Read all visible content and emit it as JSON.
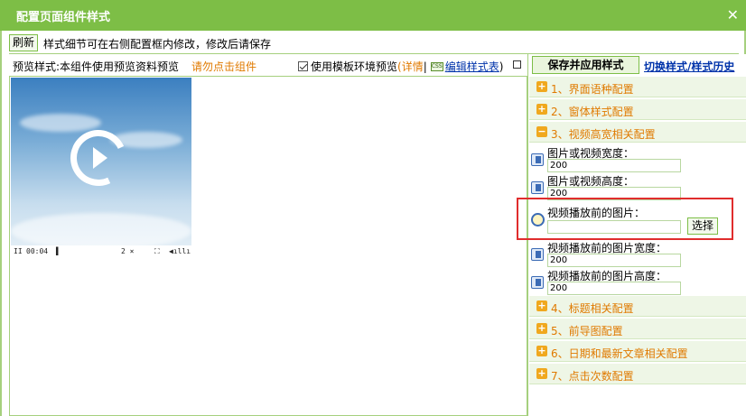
{
  "dialog": {
    "title": "配置页面组件样式",
    "close_glyph": "✕"
  },
  "toolbar": {
    "refresh_label": "刷新",
    "tip": "样式细节可在右侧配置框内修改，修改后请保存"
  },
  "preview": {
    "label": "预览样式:本组件使用预览资料预览",
    "warning": "请勿点击组件",
    "use_template_label": "使用模板环境预览",
    "use_template_checked": true,
    "detail_prefix": "(",
    "detail_label": "详情",
    "separator": "|",
    "css_icon_text": "CSS",
    "edit_style_label": "编辑样式表",
    "close_paren": ")"
  },
  "player": {
    "pause_glyph": "II",
    "time": "00:04",
    "marker": "▌",
    "zoom": "2 ×",
    "fullscreen_glyph": "⛶",
    "volume_glyph": "◀ıllı"
  },
  "right_panel": {
    "save_label": "保存并应用样式",
    "history_label": "切换样式/样式历史",
    "sections": [
      {
        "glyph": "+",
        "label": "1、界面语种配置"
      },
      {
        "glyph": "+",
        "label": "2、窗体样式配置"
      },
      {
        "glyph": "−",
        "label": "3、视频高宽相关配置"
      },
      {
        "glyph": "+",
        "label": "4、标题相关配置"
      },
      {
        "glyph": "+",
        "label": "5、前导图配置"
      },
      {
        "glyph": "+",
        "label": "6、日期和最新文章相关配置"
      },
      {
        "glyph": "+",
        "label": "7、点击次数配置"
      }
    ],
    "fields": [
      {
        "label": "图片或视频宽度：",
        "value": "200"
      },
      {
        "label": "图片或视频高度：",
        "value": "200"
      },
      {
        "label": "视频播放前的图片：",
        "value": ""
      },
      {
        "label": "视频播放前的图片宽度：",
        "value": "200"
      },
      {
        "label": "视频播放前的图片高度：",
        "value": "200"
      }
    ],
    "choose_label": "选择"
  },
  "colors": {
    "titlebar": "#7dbe46",
    "section_label": "#e07a00",
    "link": "#0033aa",
    "highlight": "#e02d2d"
  }
}
